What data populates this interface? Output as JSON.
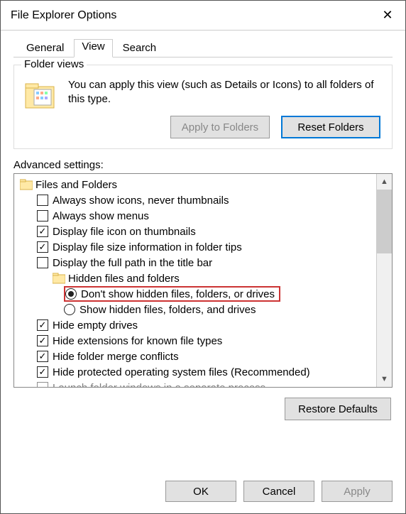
{
  "window_title": "File Explorer Options",
  "tabs": {
    "general": "General",
    "view": "View",
    "search": "Search",
    "active": "view"
  },
  "folder_views": {
    "group_label": "Folder views",
    "description": "You can apply this view (such as Details or Icons) to all folders of this type.",
    "apply_btn": "Apply to Folders",
    "reset_btn": "Reset Folders"
  },
  "advanced_label": "Advanced settings:",
  "tree": {
    "root_label": "Files and Folders",
    "items": [
      {
        "kind": "checkbox",
        "checked": false,
        "label": "Always show icons, never thumbnails"
      },
      {
        "kind": "checkbox",
        "checked": false,
        "label": "Always show menus"
      },
      {
        "kind": "checkbox",
        "checked": true,
        "label": "Display file icon on thumbnails"
      },
      {
        "kind": "checkbox",
        "checked": true,
        "label": "Display file size information in folder tips"
      },
      {
        "kind": "checkbox",
        "checked": false,
        "label": "Display the full path in the title bar"
      }
    ],
    "hidden_group_label": "Hidden files and folders",
    "hidden_radio": [
      {
        "selected": true,
        "label": "Don't show hidden files, folders, or drives",
        "highlight": true
      },
      {
        "selected": false,
        "label": "Show hidden files, folders, and drives",
        "highlight": false
      }
    ],
    "items2": [
      {
        "kind": "checkbox",
        "checked": true,
        "label": "Hide empty drives"
      },
      {
        "kind": "checkbox",
        "checked": true,
        "label": "Hide extensions for known file types"
      },
      {
        "kind": "checkbox",
        "checked": true,
        "label": "Hide folder merge conflicts"
      },
      {
        "kind": "checkbox",
        "checked": true,
        "label": "Hide protected operating system files (Recommended)"
      },
      {
        "kind": "checkbox",
        "checked": false,
        "label": "Launch folder windows in a separate process"
      }
    ]
  },
  "restore_btn": "Restore Defaults",
  "footer": {
    "ok": "OK",
    "cancel": "Cancel",
    "apply": "Apply"
  }
}
